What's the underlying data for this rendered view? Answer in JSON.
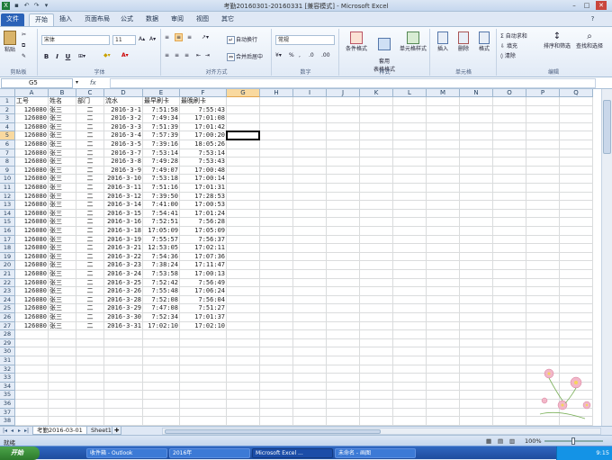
{
  "window": {
    "title": "考勤20160301-20160331 [兼容模式] - Microsoft Excel",
    "controls": [
      "–",
      "□",
      "✕"
    ]
  },
  "tabs": {
    "file": "文件",
    "items": [
      "开始",
      "插入",
      "页面布局",
      "公式",
      "数据",
      "审阅",
      "视图",
      "其它"
    ]
  },
  "ribbon": {
    "clipboard": {
      "label": "剪贴板",
      "paste": "粘贴"
    },
    "font": {
      "label": "字体",
      "font_name": "宋体",
      "font_size": "11",
      "bold": "B",
      "italic": "I",
      "underline": "U"
    },
    "alignment": {
      "label": "对齐方式",
      "wrap": "自动换行",
      "merge": "合并后居中"
    },
    "number": {
      "label": "数字",
      "format": "常规",
      "percent": "%",
      "comma": ","
    },
    "styles": {
      "label": "样式",
      "conditional": "条件格式",
      "table": "套用\n表格格式",
      "cell_styles": "单元格样式"
    },
    "cells": {
      "label": "单元格",
      "insert": "插入",
      "delete": "删除",
      "format": "格式"
    },
    "editing": {
      "label": "编辑",
      "autosum": "自动求和",
      "fill": "填充",
      "clear": "清除",
      "sort": "排序和筛选",
      "find": "查找和选择"
    }
  },
  "formula_bar": {
    "name_box": "G5",
    "fx": "fx",
    "content": ""
  },
  "columns": [
    "A",
    "B",
    "C",
    "D",
    "E",
    "F",
    "G",
    "H",
    "I",
    "J",
    "K",
    "L",
    "M",
    "N",
    "O",
    "P",
    "Q"
  ],
  "selected_cell": "G5",
  "headers": [
    "工号",
    "姓名",
    "部门",
    "流水",
    "最早刷卡",
    "最晚刷卡"
  ],
  "rows": [
    [
      "126080",
      "张三",
      "二",
      "2016-3-1",
      "7:51:58",
      "7:55:43"
    ],
    [
      "126080",
      "张三",
      "二",
      "2016-3-2",
      "7:49:34",
      "17:01:08"
    ],
    [
      "126080",
      "张三",
      "二",
      "2016-3-3",
      "7:51:39",
      "17:01:42"
    ],
    [
      "126080",
      "张三",
      "二",
      "2016-3-4",
      "7:57:39",
      "17:00:20"
    ],
    [
      "126080",
      "张三",
      "二",
      "2016-3-5",
      "7:39:16",
      "18:05:26"
    ],
    [
      "126080",
      "张三",
      "二",
      "2016-3-7",
      "7:53:14",
      "7:53:14"
    ],
    [
      "126080",
      "张三",
      "二",
      "2016-3-8",
      "7:49:28",
      "7:53:43"
    ],
    [
      "126080",
      "张三",
      "二",
      "2016-3-9",
      "7:49:07",
      "17:00:48"
    ],
    [
      "126080",
      "张三",
      "二",
      "2016-3-10",
      "7:53:18",
      "17:00:14"
    ],
    [
      "126080",
      "张三",
      "二",
      "2016-3-11",
      "7:51:16",
      "17:01:31"
    ],
    [
      "126080",
      "张三",
      "二",
      "2016-3-12",
      "7:39:50",
      "17:28:53"
    ],
    [
      "126080",
      "张三",
      "二",
      "2016-3-14",
      "7:41:00",
      "17:00:53"
    ],
    [
      "126080",
      "张三",
      "二",
      "2016-3-15",
      "7:54:41",
      "17:01:24"
    ],
    [
      "126080",
      "张三",
      "二",
      "2016-3-16",
      "7:52:51",
      "7:56:28"
    ],
    [
      "126080",
      "张三",
      "二",
      "2016-3-18",
      "17:05:09",
      "17:05:09"
    ],
    [
      "126080",
      "张三",
      "二",
      "2016-3-19",
      "7:55:57",
      "7:56:37"
    ],
    [
      "126080",
      "张三",
      "二",
      "2016-3-21",
      "12:53:05",
      "17:02:11"
    ],
    [
      "126080",
      "张三",
      "二",
      "2016-3-22",
      "7:54:36",
      "17:07:36"
    ],
    [
      "126080",
      "张三",
      "二",
      "2016-3-23",
      "7:38:24",
      "17:11:47"
    ],
    [
      "126080",
      "张三",
      "二",
      "2016-3-24",
      "7:53:58",
      "17:00:13"
    ],
    [
      "126080",
      "张三",
      "二",
      "2016-3-25",
      "7:52:42",
      "7:56:49"
    ],
    [
      "126080",
      "张三",
      "二",
      "2016-3-26",
      "7:55:48",
      "17:06:24"
    ],
    [
      "126080",
      "张三",
      "二",
      "2016-3-28",
      "7:52:08",
      "7:56:04"
    ],
    [
      "126080",
      "张三",
      "二",
      "2016-3-29",
      "7:47:08",
      "7:51:27"
    ],
    [
      "126080",
      "张三",
      "二",
      "2016-3-30",
      "7:52:34",
      "17:01:37"
    ],
    [
      "126080",
      "张三",
      "二",
      "2016-3-31",
      "17:02:10",
      "17:02:10"
    ]
  ],
  "total_rows": 39,
  "sheets": [
    "考勤2016-03-01",
    "Sheet1"
  ],
  "active_sheet": 0,
  "status": {
    "text": "就绪",
    "zoom": "100%"
  },
  "taskbar": {
    "start": "开始",
    "buttons": [
      "收件箱 - Outlook",
      "2016年",
      "Microsoft Excel ...",
      "未命名 - 画图"
    ],
    "active_button": 2,
    "clock": "9:15"
  }
}
